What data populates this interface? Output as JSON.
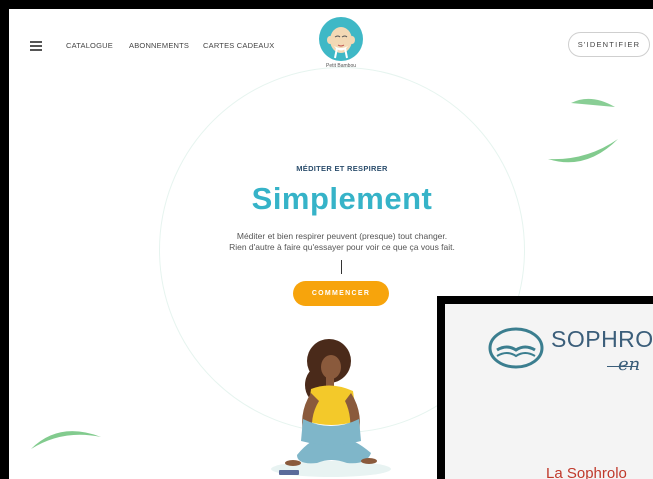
{
  "nav": {
    "links": [
      "CATALOGUE",
      "ABONNEMENTS",
      "CARTES CADEAUX"
    ],
    "logo_name": "Petit Bambou",
    "login_label": "S'IDENTIFIER"
  },
  "hero": {
    "kicker": "MÉDITER ET RESPIRER",
    "headline": "Simplement",
    "subtitle_line1": "Méditer et bien respirer peuvent (presque) tout changer.",
    "subtitle_line2": "Rien d'autre à faire qu'essayer pour voir ce que ça vous fait.",
    "cta_label": "COMMENCER"
  },
  "overlay": {
    "brand": "SOPHROLO",
    "brand_sub": "en",
    "title": "La Sophrolo"
  },
  "colors": {
    "headline": "#36b3c8",
    "cta": "#f7a40c",
    "leaf": "#6cc27a",
    "overlay_title": "#c0392b"
  }
}
